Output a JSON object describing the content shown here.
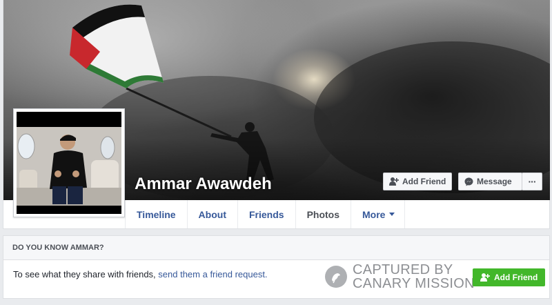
{
  "profile": {
    "name": "Ammar Awawdeh"
  },
  "cover_actions": {
    "add_friend": "Add Friend",
    "message": "Message",
    "more": "···"
  },
  "nav": {
    "tabs": [
      {
        "label": "Timeline",
        "active": false
      },
      {
        "label": "About",
        "active": false
      },
      {
        "label": "Friends",
        "active": false
      },
      {
        "label": "Photos",
        "active": true
      },
      {
        "label": "More",
        "active": false
      }
    ]
  },
  "know_card": {
    "header": "DO YOU KNOW AMMAR?",
    "text": "To see what they share with friends, ",
    "link": "send them a friend request.",
    "add_friend": "Add Friend"
  },
  "watermark": {
    "line1": "CAPTURED BY",
    "line2": "CANARY MISSION"
  },
  "colors": {
    "link": "#365899",
    "green": "#42b72a",
    "page_bg": "#e9ebee"
  },
  "icons": [
    "add-friend-icon",
    "messenger-icon",
    "canary-mission-logo"
  ]
}
